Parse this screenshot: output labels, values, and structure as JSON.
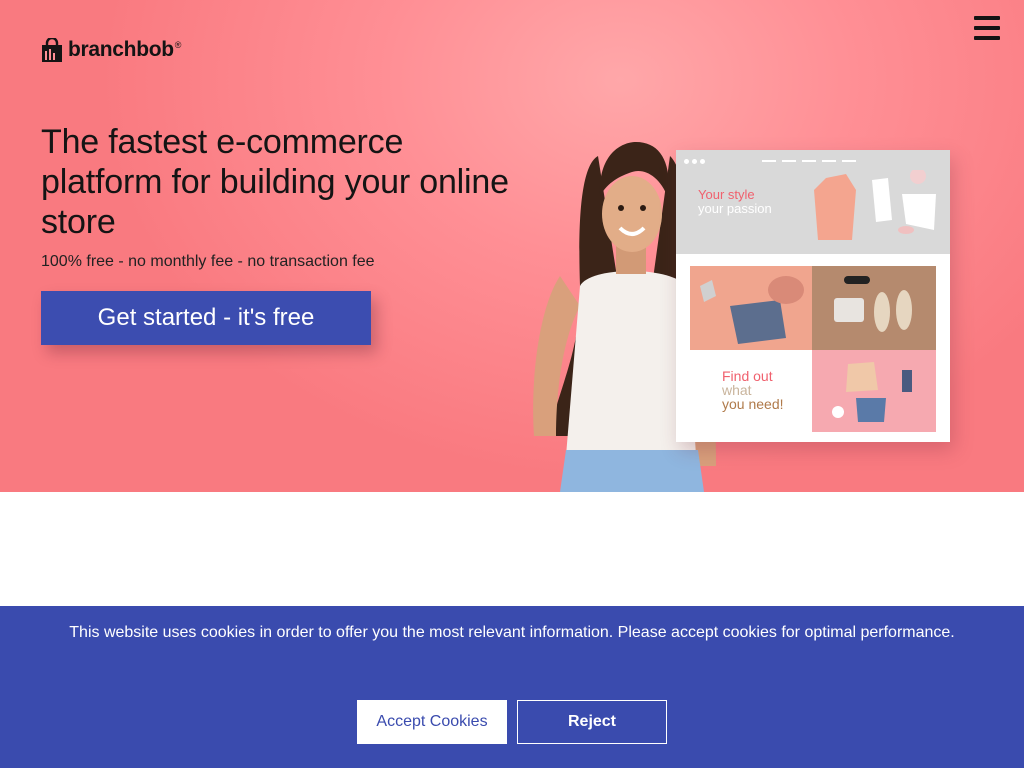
{
  "header": {
    "logo_text": "branchbob",
    "logo_mark": "®",
    "menu_icon": "hamburger-menu-icon"
  },
  "hero": {
    "headline": "The fastest e-commerce platform for building your online store",
    "subline": "100% free - no monthly fee - no transaction fee",
    "cta_label": "Get started - it's free",
    "mockup": {
      "banner_line1": "Your style",
      "banner_line2": "your passion",
      "find_line1": "Find out",
      "find_line2": "what",
      "find_line3": "you need!"
    }
  },
  "cookie_banner": {
    "message": "This website uses cookies in order to offer you the most relevant information. Please accept cookies for optimal performance.",
    "accept_label": "Accept Cookies",
    "reject_label": "Reject"
  },
  "colors": {
    "hero_bg": "#ff8f95",
    "brand_blue": "#3c4db0",
    "cookie_bg": "#3a4bae"
  }
}
